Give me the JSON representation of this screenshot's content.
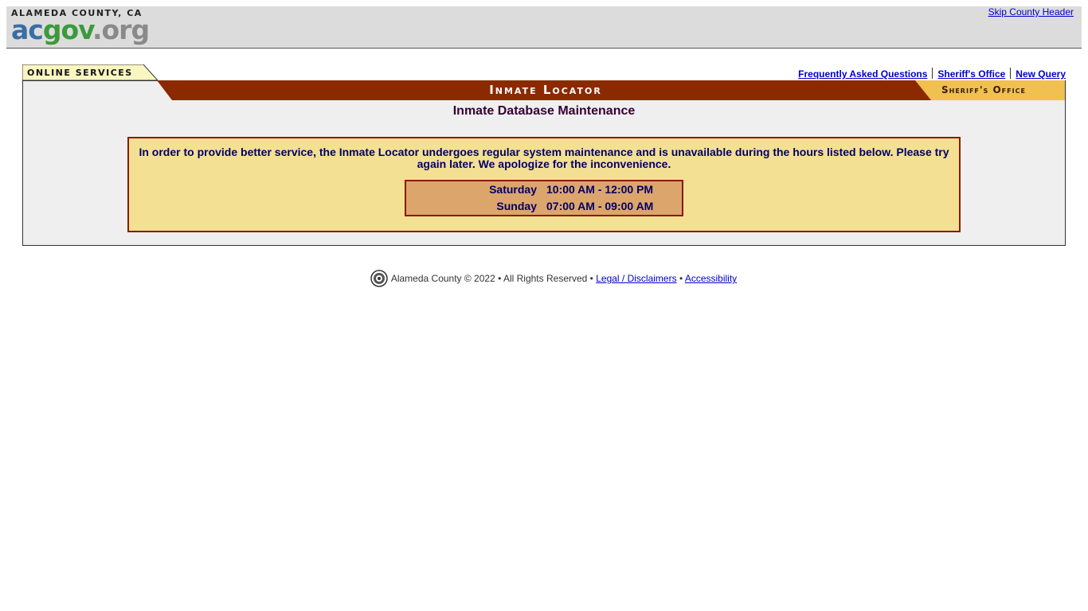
{
  "county_header": {
    "county_name": "ALAMEDA COUNTY, CA",
    "logo_ac": "ac",
    "logo_gov": "gov",
    "logo_org": ".org",
    "skip_link": "Skip County Header",
    "colors": {
      "ac": "#3a6ea5",
      "gov": "#3c9a3c",
      "org": "#8a8a8a"
    }
  },
  "nav": {
    "online_services": "ONLINE SERVICES",
    "links": [
      "Frequently Asked Questions",
      "Sheriff's Office",
      "New Query"
    ]
  },
  "banner": {
    "title": "Inmate Locator",
    "department": "Sheriff's Office",
    "colors": {
      "bar": "#8b2a00",
      "department_tab": "#f0c050"
    }
  },
  "main": {
    "page_title": "Inmate Database Maintenance",
    "notice": "In order to provide better service, the Inmate Locator undergoes regular system maintenance and is unavailable during the hours listed below.  Please try again later.  We apologize for the inconvenience.",
    "schedule": [
      {
        "day": "Saturday",
        "hours": "10:00 AM - 12:00 PM"
      },
      {
        "day": "Sunday",
        "hours": "07:00 AM - 09:00 AM"
      }
    ]
  },
  "footer": {
    "copyright": "Alameda County © 2022 • All Rights Reserved •",
    "legal_link": "Legal / Disclaimers",
    "separator": "•",
    "accessibility_link": "Accessibility",
    "seal_icon": "county-seal-icon"
  }
}
